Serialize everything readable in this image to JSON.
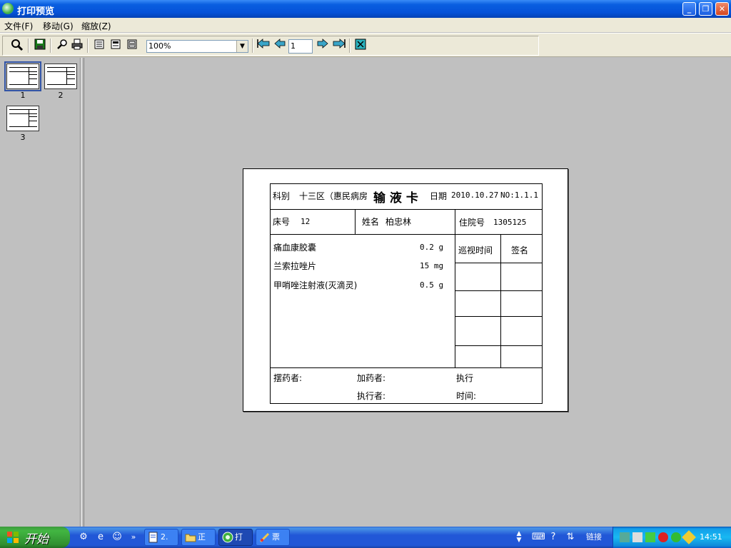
{
  "window": {
    "title": "打印预览",
    "controls": {
      "minimize": "_",
      "maximize": "❐",
      "close": "✕"
    }
  },
  "menu": [
    "文件(F)",
    "移动(G)",
    "缩放(Z)"
  ],
  "toolbar": {
    "buttons": [
      "zoom-icon",
      "save-icon",
      "find-icon",
      "print-icon",
      "single-page-icon",
      "multi-page-icon",
      "page-setup-icon",
      "first-page-icon",
      "prev-page-icon",
      "next-page-icon",
      "last-page-icon",
      "exit-icon"
    ],
    "zoom_value": "100%",
    "page_value": "1"
  },
  "thumbnails": [
    "1",
    "2",
    "3"
  ],
  "card": {
    "dept_label": "科别",
    "dept_value": "十三区（惠民病房",
    "title": "输 液 卡",
    "date_label": "日期",
    "date_value": "2010.10.27",
    "no": "NO:1.1.1",
    "bed_label": "床号",
    "bed_value": "12",
    "name_label": "姓名",
    "name_value": "柏忠林",
    "admission_label": "住院号",
    "admission_value": "1305125",
    "drugs": [
      {
        "name": "痛血康胶囊",
        "dose": "0.2 g"
      },
      {
        "name": "兰索拉唑片",
        "dose": "15 mg"
      },
      {
        "name": "甲哨唑注射液(灭滴灵)",
        "dose": "0.5 g"
      }
    ],
    "patrol_time_label": "巡视时间",
    "signature_label": "签名",
    "dispenser_label": "摆药者:",
    "adder_label": "加药者:",
    "exec_label": "执行",
    "executor_label": "执行者:",
    "time_label": "时间:"
  },
  "taskbar": {
    "start_label": "开始",
    "tasks": [
      {
        "label": "2.",
        "icon": "document-icon"
      },
      {
        "label": "正",
        "icon": "folder-icon"
      },
      {
        "label": "打",
        "icon": "app-icon"
      },
      {
        "label": "票",
        "icon": "paint-icon"
      }
    ],
    "links_label": "链接",
    "clock": "14:51"
  }
}
